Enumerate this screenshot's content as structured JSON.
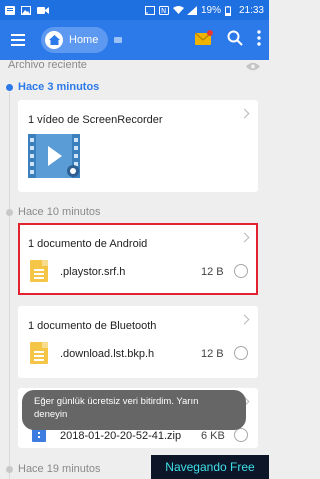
{
  "status_bar": {
    "battery": "19%",
    "time": "21:33"
  },
  "header": {
    "home_label": "Home"
  },
  "recent": {
    "label": "Archivo reciente"
  },
  "sections": [
    {
      "time_label": "Hace 3 minutos",
      "card_title": "1 vídeo de ScreenRecorder"
    },
    {
      "time_label": "Hace 10 minutos",
      "card_title": "1 documento de Android",
      "file_name": ".playstor.srf.h",
      "file_size": "12 B"
    },
    {
      "card_title": "1 documento de Bluetooth",
      "file_name": ".download.lst.bkp.h",
      "file_size": "12 B"
    },
    {
      "file_name": "2018-01-20-20-52-41.zip",
      "file_size": "6 KB"
    },
    {
      "time_label": "Hace 19 minutos"
    }
  ],
  "toast": {
    "text": "Eğer günlük ücretsiz veri bitirdim. Yarın deneyin"
  },
  "overlay_badge": {
    "text": "Navegando Free"
  },
  "colors": {
    "appbar": "#2c79ea",
    "statusbar": "#1e6fe0",
    "accent": "#2c79ea",
    "highlight": "#e32230"
  }
}
